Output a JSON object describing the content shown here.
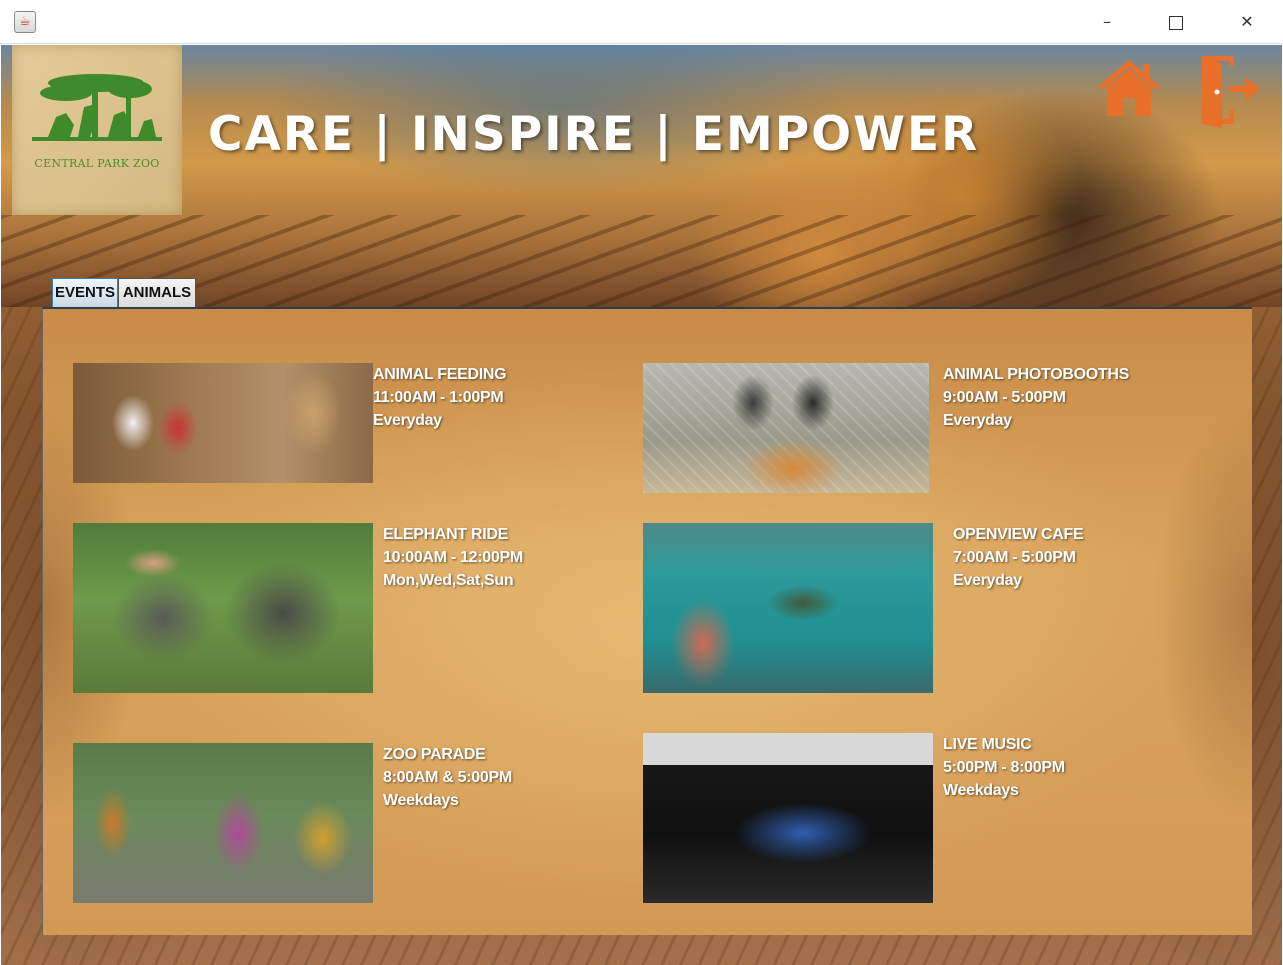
{
  "window": {
    "app_icon": "java-cup-icon",
    "minimize_glyph": "–",
    "close_glyph": "✕"
  },
  "header": {
    "logo_text": "CENTRAL PARK ZOO",
    "slogan": "CARE  |  INSPIRE  |  EMPOWER",
    "home_icon": "home-icon",
    "exit_icon": "exit-door-icon",
    "accent_color": "#e8702a"
  },
  "tabs": [
    {
      "label": "EVENTS",
      "selected": true
    },
    {
      "label": "ANIMALS",
      "selected": false
    }
  ],
  "events": [
    {
      "title": "ANIMAL FEEDING",
      "time": "11:00AM - 1:00PM",
      "days": "Everyday"
    },
    {
      "title": "ANIMAL PHOTOBOOTHS",
      "time": "9:00AM - 5:00PM",
      "days": "Everyday"
    },
    {
      "title": "ELEPHANT RIDE",
      "time": "10:00AM - 12:00PM",
      "days": "Mon,Wed,Sat,Sun"
    },
    {
      "title": "OPENVIEW CAFE",
      "time": "7:00AM - 5:00PM",
      "days": "Everyday"
    },
    {
      "title": "ZOO PARADE",
      "time": "8:00AM & 5:00PM",
      "days": "Weekdays"
    },
    {
      "title": "LIVE MUSIC",
      "time": "5:00PM - 8:00PM",
      "days": "Weekdays"
    }
  ]
}
